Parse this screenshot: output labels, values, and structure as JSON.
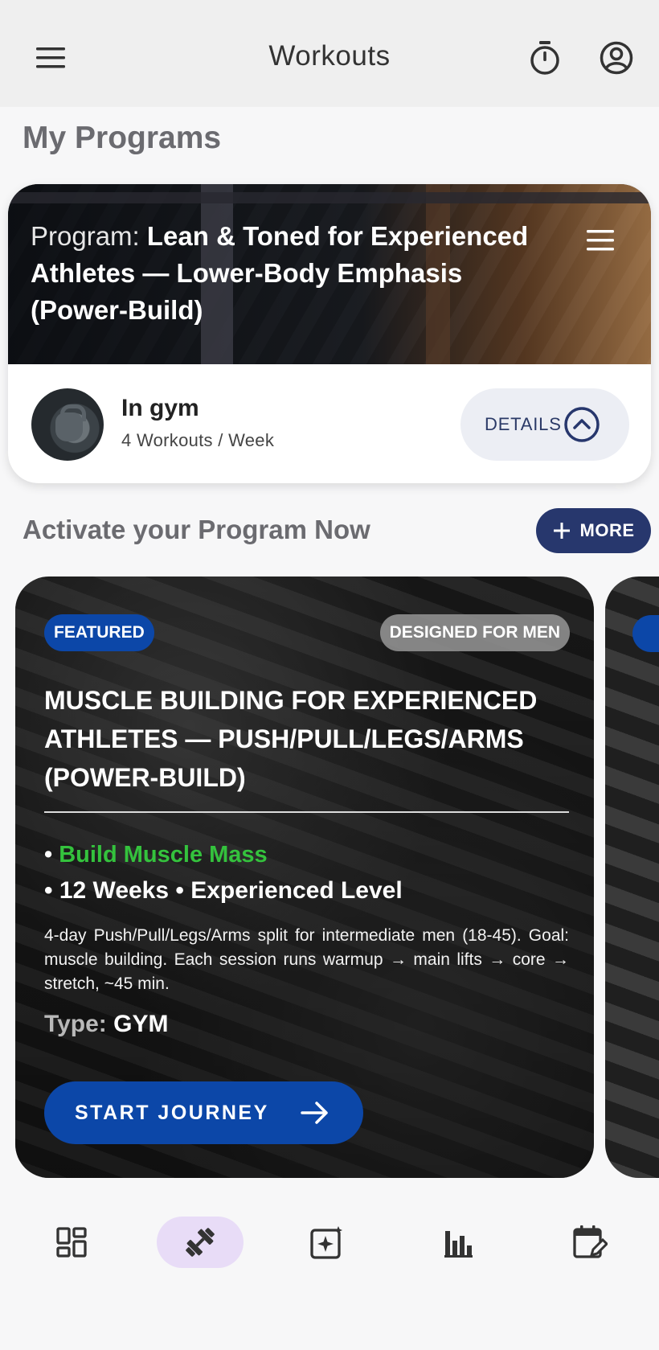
{
  "app_bar": {
    "title": "Workouts",
    "icons": [
      "menu-icon",
      "timer-icon",
      "account-icon"
    ]
  },
  "my_programs": {
    "heading": "My Programs",
    "program": {
      "title_prefix": "Program: ",
      "title": "Lean & Toned for Experienced Athletes — Lower-Body Emphasis (Power-Build)",
      "location": "In gym",
      "frequency": "4 Workouts / Week",
      "details_label": "DETAILS"
    }
  },
  "activate": {
    "heading": "Activate your Program Now",
    "more_label": "MORE"
  },
  "featured_card": {
    "badge_featured": "FEATURED",
    "badge_audience": "DESIGNED FOR MEN",
    "title": "MUSCLE BUILDING FOR EXPERIENCED ATHLETES — PUSH/PULL/LEGS/ARMS (POWER-BUILD)",
    "goal": "Build Muscle Mass",
    "meta": "• 12 Weeks • Experienced Level",
    "description": "4-day Push/Pull/Legs/Arms split for intermediate men (18-45). Goal: muscle building. Each session runs warmup → main lifts → core → stretch, ~45 min.",
    "type_label": "Type: ",
    "type_value": "GYM",
    "start_label": "START JOURNEY"
  },
  "colors": {
    "primary": "#0c47a8",
    "navy": "#27376d",
    "goal_green": "#34c23d",
    "nav_active_bg": "#e8dcf7"
  },
  "bottom_nav": [
    "dashboard-icon",
    "workouts-icon",
    "ai-sparkle-icon",
    "stats-icon",
    "calendar-edit-icon"
  ]
}
